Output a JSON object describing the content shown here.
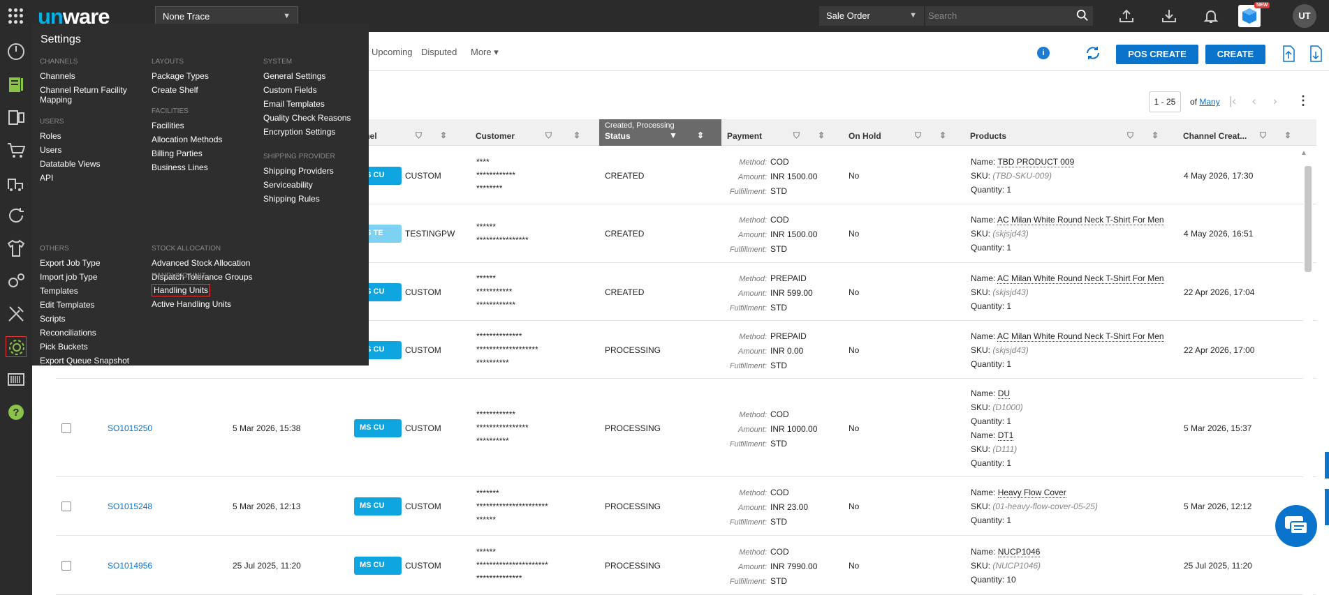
{
  "topbar": {
    "logo_prefix": "un",
    "logo_suffix": "ware",
    "facility": "None Trace",
    "module": "Sale Order",
    "search_placeholder": "Search",
    "new_badge": "NEW",
    "avatar": "UT"
  },
  "menu": {
    "title": "Settings",
    "columns": [
      {
        "sections": [
          {
            "heading": "CHANNELS",
            "items": [
              "Channels",
              "Channel Return Facility Mapping"
            ]
          },
          {
            "heading": "USERS",
            "items": [
              "Roles",
              "Users",
              "Datatable Views",
              "API"
            ]
          },
          {
            "heading": "OTHERS",
            "items": [
              "Export Job Type",
              "Import job Type",
              "Templates",
              "Edit Templates",
              "Scripts",
              "Reconciliations",
              "Pick Buckets",
              "Export Queue Snapshot"
            ]
          }
        ]
      },
      {
        "sections": [
          {
            "heading": "LAYOUTS",
            "items": [
              "Package Types",
              "Create Shelf"
            ]
          },
          {
            "heading": "FACILITIES",
            "items": [
              "Facilities",
              "Allocation Methods",
              "Billing Parties",
              "Business Lines"
            ]
          },
          {
            "heading": "STOCK ALLOCATION",
            "items": [
              "Advanced Stock Allocation",
              "Dispatch Tolerance Groups"
            ]
          },
          {
            "heading": "HANDLING UNIT",
            "items": [
              "Handling Units",
              "Active Handling Units"
            ]
          }
        ]
      },
      {
        "sections": [
          {
            "heading": "SYSTEM",
            "items": [
              "General Settings",
              "Custom Fields",
              "Email Templates",
              "Quality Check Reasons",
              "Encryption Settings"
            ]
          },
          {
            "heading": "SHIPPING PROVIDER",
            "items": [
              "Shipping Providers",
              "Serviceability",
              "Shipping Rules"
            ]
          }
        ]
      }
    ]
  },
  "tabs": {
    "upcoming": "Upcoming",
    "disputed": "Disputed",
    "more": "More ▾"
  },
  "actions": {
    "info": "i",
    "pos_create": "POS CREATE",
    "create": "CREATE"
  },
  "pager": {
    "range": "1 - 25",
    "of": "of",
    "total": "Many"
  },
  "table": {
    "headers": {
      "channel": "nnel",
      "customer": "Customer",
      "status_filter": "Created, Processing",
      "status": "Status",
      "payment": "Payment",
      "on_hold": "On Hold",
      "products": "Products",
      "channel_created": "Channel Creat..."
    },
    "pay_labels": {
      "method": "Method:",
      "amount": "Amount:",
      "fulfillment": "Fulfillment:"
    },
    "prod_labels": {
      "name": "Name:",
      "sku": "SKU:",
      "qty": "Quantity:"
    },
    "rows": [
      {
        "so": "",
        "created": "",
        "badge": "CU",
        "channel": "CUSTOM",
        "customer": [
          "****",
          "************",
          "********"
        ],
        "status": "CREATED",
        "method": "COD",
        "amount": "INR 1500.00",
        "fulfillment": "STD",
        "hold": "No",
        "products": [
          {
            "name": "TBD PRODUCT 009",
            "sku": "(TBD-SKU-009)",
            "qty": "1"
          }
        ],
        "channel_created": "4 May 2026, 17:30"
      },
      {
        "so": "",
        "created": "",
        "badge": "TE",
        "channel": "TESTINGPW",
        "customer": [
          "******",
          "****************"
        ],
        "status": "CREATED",
        "method": "COD",
        "amount": "INR 1500.00",
        "fulfillment": "STD",
        "hold": "No",
        "products": [
          {
            "name": "AC Milan  White Round Neck T-Shirt For Men",
            "sku": "(skjsjd43)",
            "qty": "1"
          }
        ],
        "channel_created": "4 May 2026, 16:51"
      },
      {
        "so": "",
        "created": "",
        "badge": "CU",
        "channel": "CUSTOM",
        "customer": [
          "******",
          "***********",
          "************"
        ],
        "status": "CREATED",
        "method": "PREPAID",
        "amount": "INR 599.00",
        "fulfillment": "STD",
        "hold": "No",
        "products": [
          {
            "name": "AC Milan  White Round Neck T-Shirt For Men",
            "sku": "(skjsjd43)",
            "qty": "1"
          }
        ],
        "channel_created": "22 Apr 2026, 17:04"
      },
      {
        "so": "",
        "created": "",
        "badge": "CU",
        "channel": "CUSTOM",
        "customer": [
          "**************",
          "*******************",
          "**********"
        ],
        "status": "PROCESSING",
        "method": "PREPAID",
        "amount": "INR 0.00",
        "fulfillment": "STD",
        "hold": "No",
        "products": [
          {
            "name": "AC Milan  White Round Neck T-Shirt For Men",
            "sku": "(skjsjd43)",
            "qty": "1"
          }
        ],
        "channel_created": "22 Apr 2026, 17:00"
      },
      {
        "so": "SO1015250",
        "created": "5 Mar 2026, 15:38",
        "badge": "CU",
        "channel": "CUSTOM",
        "customer": [
          "************",
          "****************",
          "**********"
        ],
        "status": "PROCESSING",
        "method": "COD",
        "amount": "INR 1000.00",
        "fulfillment": "STD",
        "hold": "No",
        "products": [
          {
            "name": "DU",
            "sku": "(D1000)",
            "qty": "1"
          },
          {
            "name": "DT1",
            "sku": "(D111)",
            "qty": "1"
          }
        ],
        "channel_created": "5 Mar 2026, 15:37"
      },
      {
        "so": "SO1015248",
        "created": "5 Mar 2026, 12:13",
        "badge": "CU",
        "channel": "CUSTOM",
        "customer": [
          "*******",
          "**********************",
          "******"
        ],
        "status": "PROCESSING",
        "method": "COD",
        "amount": "INR 23.00",
        "fulfillment": "STD",
        "hold": "No",
        "products": [
          {
            "name": "Heavy Flow Cover",
            "sku": "(01-heavy-flow-cover-05-25)",
            "qty": "1"
          }
        ],
        "channel_created": "5 Mar 2026, 12:12"
      },
      {
        "so": "SO1014956",
        "created": "25 Jul 2025, 11:20",
        "badge": "CU",
        "channel": "CUSTOM",
        "customer": [
          "******",
          "**********************",
          "**************"
        ],
        "status": "PROCESSING",
        "method": "COD",
        "amount": "INR 7990.00",
        "fulfillment": "STD",
        "hold": "No",
        "products": [
          {
            "name": "NUCP1046",
            "sku": "(NUCP1046)",
            "qty": "10"
          }
        ],
        "channel_created": "25 Jul 2025, 11:20"
      }
    ]
  },
  "icons": {
    "sidebar": [
      "dashboard-icon",
      "orders-icon",
      "products-icon",
      "cart-icon",
      "warehouse-icon",
      "returns-icon",
      "shirt-icon",
      "settings-cogs-icon",
      "tools-icon",
      "settings-gear-icon",
      "barcode-icon",
      "help-icon"
    ]
  },
  "colors": {
    "accent": "#0a73cc",
    "topbar": "#2b2b2b",
    "badge": "#0ea5e0",
    "highlight": "#e53935",
    "logo_accent": "#00b1e8"
  }
}
